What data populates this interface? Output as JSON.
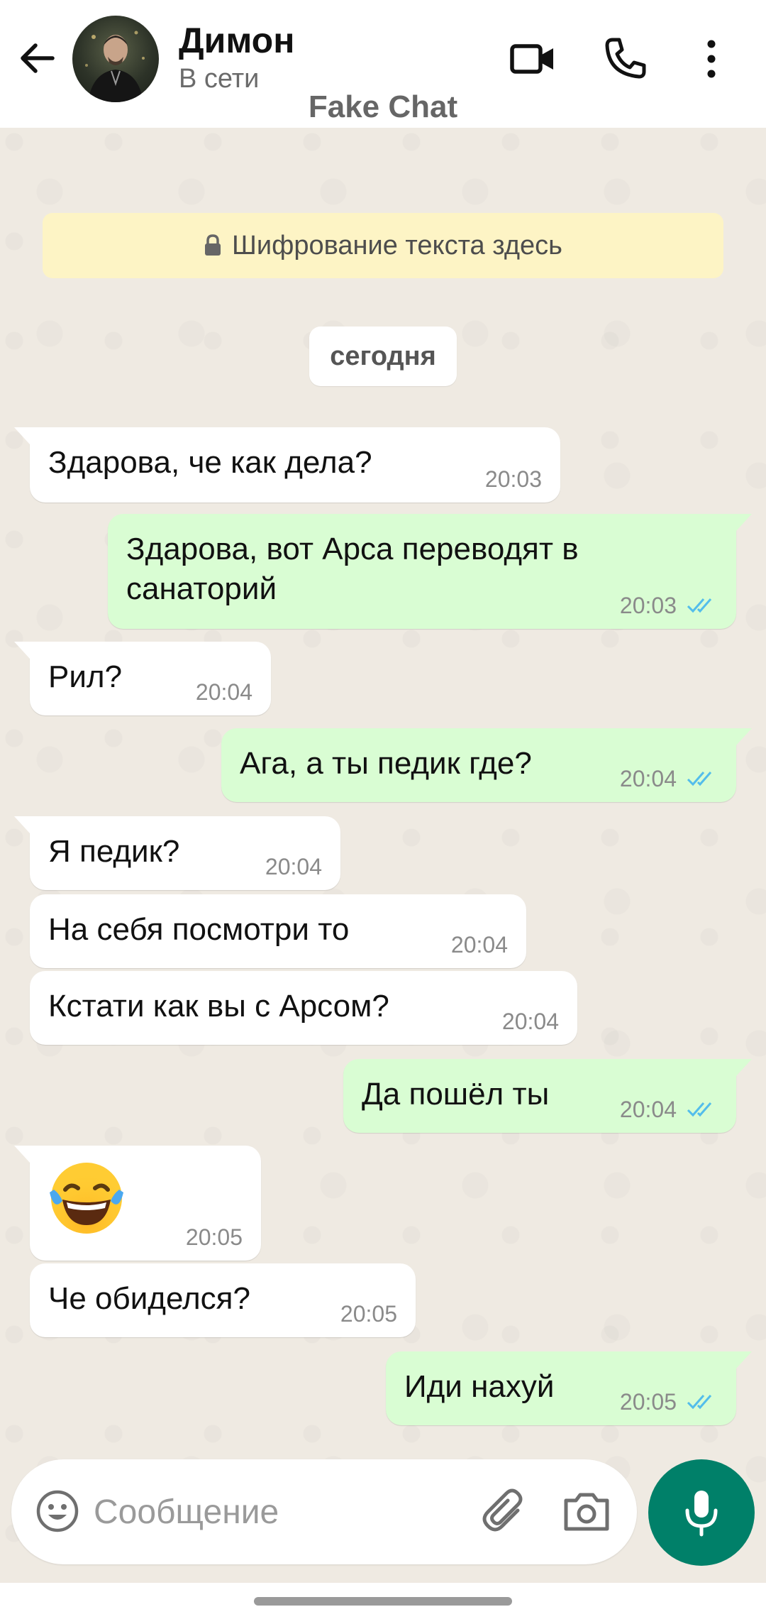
{
  "header": {
    "contact_name": "Димон",
    "status": "В сети",
    "watermark": "Fake Chat",
    "icons": {
      "back": "arrow-left-icon",
      "video": "video-camera-icon",
      "call": "phone-icon",
      "menu": "more-vert-icon"
    }
  },
  "chat": {
    "encryption_notice": "Шифрование текста здесь",
    "date_label": "сегодня",
    "messages": [
      {
        "dir": "in",
        "text": "Здарова, че как дела?",
        "time": "20:03"
      },
      {
        "dir": "out",
        "text": "Здарова, вот Арса переводят в\nсанаторий",
        "time": "20:03",
        "read": true
      },
      {
        "dir": "in",
        "text": "Рил?",
        "time": "20:04"
      },
      {
        "dir": "out",
        "text": "Ага, а ты педик где?",
        "time": "20:04",
        "read": true
      },
      {
        "dir": "in",
        "text": "Я педик?",
        "time": "20:04"
      },
      {
        "dir": "in",
        "text": "На себя посмотри то",
        "time": "20:04"
      },
      {
        "dir": "in",
        "text": "Кстати как вы с Арсом?",
        "time": "20:04"
      },
      {
        "dir": "out",
        "text": "Да пошёл ты",
        "time": "20:04",
        "read": true
      },
      {
        "dir": "in",
        "emoji": "face-with-tears-of-joy",
        "time": "20:05"
      },
      {
        "dir": "in",
        "text": "Че обиделся?",
        "time": "20:05"
      },
      {
        "dir": "out",
        "text": "Иди нахуй",
        "time": "20:05",
        "read": true
      }
    ]
  },
  "input": {
    "placeholder": "Сообщение",
    "icons": {
      "emoji": "smiley-icon",
      "attach": "paperclip-icon",
      "camera": "camera-icon",
      "mic": "microphone-icon"
    }
  },
  "colors": {
    "incoming_bubble": "#ffffff",
    "outgoing_bubble": "#d9fdd3",
    "chat_background": "#efeae2",
    "encryption_bg": "#fdf4c5",
    "accent": "#008069",
    "read_ticks": "#53bdeb"
  }
}
